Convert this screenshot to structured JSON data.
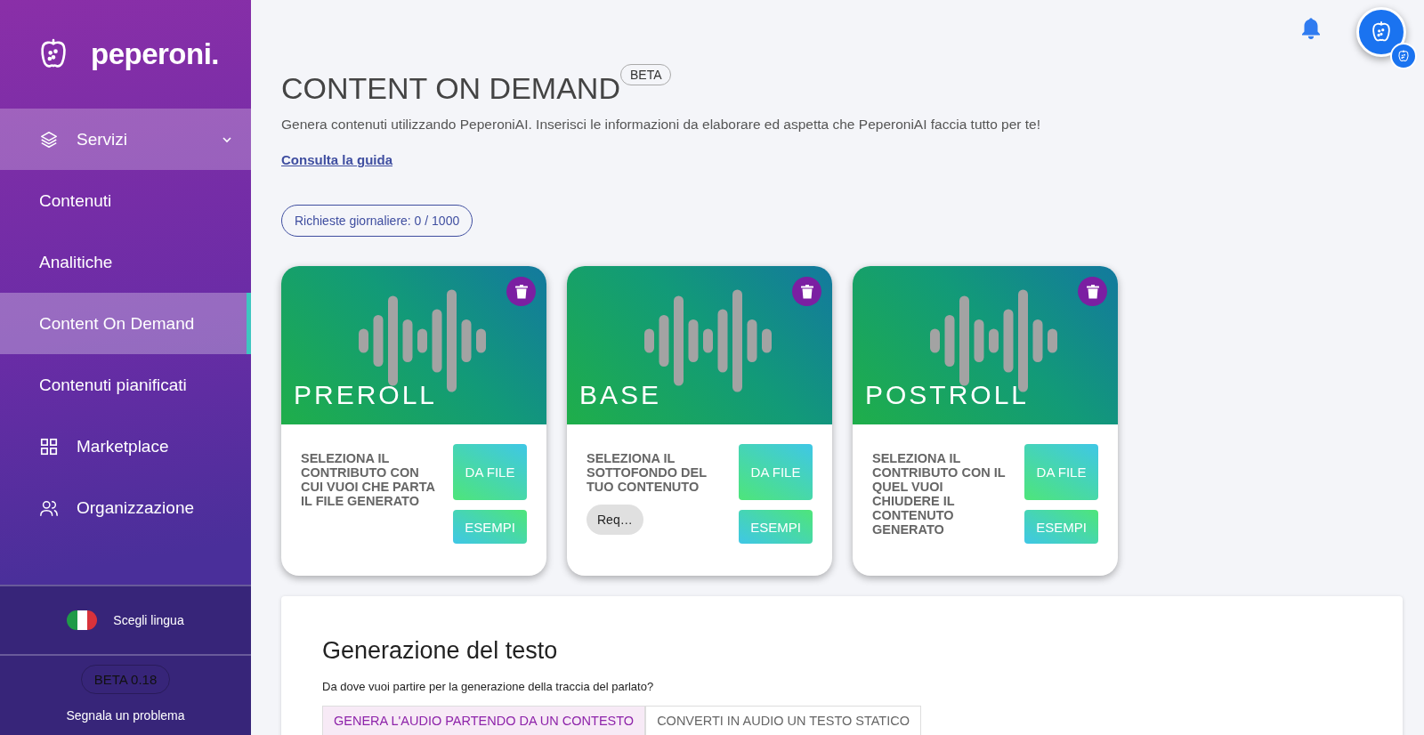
{
  "sidebar": {
    "logo": "peperoni.",
    "items": [
      {
        "label": "Servizi",
        "kind": "group",
        "expanded": true,
        "selected": false
      },
      {
        "label": "Contenuti",
        "kind": "link",
        "selected": false
      },
      {
        "label": "Analitiche",
        "kind": "link",
        "selected": false
      },
      {
        "label": "Content On Demand",
        "kind": "link",
        "selected": true
      },
      {
        "label": "Contenuti pianificati",
        "kind": "link",
        "selected": false
      },
      {
        "label": "Marketplace",
        "kind": "icon-link",
        "selected": false
      },
      {
        "label": "Organizzazione",
        "kind": "icon-link",
        "selected": false
      }
    ],
    "language": "Scegli lingua",
    "version": "BETA 0.18",
    "report": "Segnala un problema"
  },
  "page": {
    "title": "CONTENT ON DEMAND",
    "badge": "BETA",
    "description": "Genera contenuti utilizzando PeperoniAI. Inserisci le informazioni da elaborare ed aspetta che PeperoniAI faccia tutto per te!",
    "guide_link": "Consulta la guida",
    "quota": "Richieste giornaliere: 0 / 1000"
  },
  "cards": [
    {
      "title": "PREROLL",
      "description": "SELEZIONA IL CONTRIBUTO CON CUI VUOI CHE PARTA IL FILE GENERATO",
      "file_button": "DA FILE",
      "examples_button": "ESEMPI"
    },
    {
      "title": "BASE",
      "description": "SELEZIONA IL SOTTOFONDO DEL TUO CONTENUTO",
      "file_button": "DA FILE",
      "examples_button": "ESEMPI",
      "chip": "Req…"
    },
    {
      "title": "POSTROLL",
      "description": "SELEZIONA IL CONTRIBUTO CON IL QUEL VUOI CHIUDERE IL CONTENUTO GENERATO",
      "file_button": "DA FILE",
      "examples_button": "ESEMPI"
    }
  ],
  "text_generation": {
    "title": "Generazione del testo",
    "question": "Da dove vuoi partire per la generazione della traccia del parlato?",
    "tabs": [
      {
        "label": "GENERA L'AUDIO PARTENDO DA UN CONTESTO",
        "selected": true
      },
      {
        "label": "CONVERTI IN AUDIO UN TESTO STATICO",
        "selected": false
      }
    ]
  }
}
